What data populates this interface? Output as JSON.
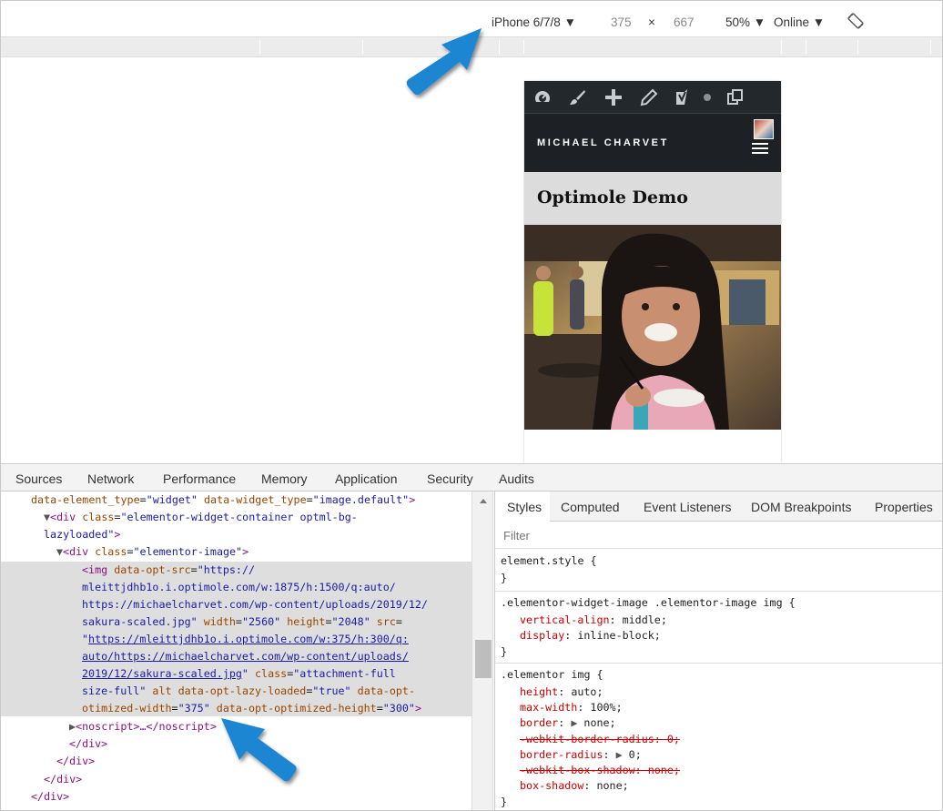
{
  "device_toolbar": {
    "device": "iPhone 6/7/8 ▼",
    "width": "375",
    "times": "×",
    "height": "667",
    "zoom": "50% ▼",
    "network": "Online ▼"
  },
  "site": {
    "title": "MICHAEL CHARVET",
    "page_title": "Optimole Demo"
  },
  "devtools_tabs": [
    "Sources",
    "Network",
    "Performance",
    "Memory",
    "Application",
    "Security",
    "Audits"
  ],
  "styles_tabs": [
    "Styles",
    "Computed",
    "Event Listeners",
    "DOM Breakpoints",
    "Properties"
  ],
  "filter_placeholder": "Filter",
  "dom": {
    "l1_a": "data-element_type",
    "l1_b": "\"widget\"",
    "l1_c": "data-widget_type",
    "l1_d": "\"image.default\"",
    "l2_a": "class",
    "l2_b": "\"elementor-widget-container optml-bg-",
    "l3": "lazyloaded\"",
    "l4_a": "class",
    "l4_b": "\"elementor-image\"",
    "l5_a": "data-opt-src",
    "l5_b": "\"https://",
    "l6": "mleittjdhb1o.i.optimole.com/w:1875/h:1500/q:auto/",
    "l7": "https://michaelcharvet.com/wp-content/uploads/2019/12/",
    "l8_a": "sakura-scaled.jpg\"",
    "l8_b": "width",
    "l8_c": "\"2560\"",
    "l8_d": "height",
    "l8_e": "\"2048\"",
    "l8_f": "src",
    "l9": "https://mleittjdhb1o.i.optimole.com/w:375/h:300/q:",
    "l10": "auto/https://michaelcharvet.com/wp-content/uploads/",
    "l11_a": "2019/12/sakura-scaled.jpg",
    "l11_b": "class",
    "l11_c": "\"attachment-full",
    "l12_a": "size-full\"",
    "l12_b": "alt",
    "l12_c": "data-opt-lazy-loaded",
    "l12_d": "\"true\"",
    "l12_e": "data-opt-",
    "l13_a": "otimized-width",
    "l13_b": "\"375\"",
    "l13_c": "data-opt-optimized-height",
    "l13_d": "\"300\"",
    "l14": "noscript",
    "l14_end": "…</noscript>",
    "l15": "</div>",
    "l16": "</div>",
    "l17": "</div>",
    "l18": "</div>"
  },
  "styles": {
    "r1_sel": "element.style {",
    "r1_end": "}",
    "r2_sel": ".elementor-widget-image .elementor-image img {",
    "r2_p1": "vertical-align",
    "r2_v1": "middle;",
    "r2_p2": "display",
    "r2_v2": "inline-block;",
    "r2_end": "}",
    "r3_sel": ".elementor img {",
    "r3_p1": "height",
    "r3_v1": "auto;",
    "r3_p2": "max-width",
    "r3_v2": "100%;",
    "r3_p3": "border",
    "r3_v3": "none;",
    "r3_p4": "-webkit-border-radius: 0;",
    "r3_p5": "border-radius",
    "r3_v5": "0;",
    "r3_p6": "-webkit-box-shadow: none;",
    "r3_p7": "box-shadow",
    "r3_v7": "none;",
    "r3_end": "}"
  }
}
